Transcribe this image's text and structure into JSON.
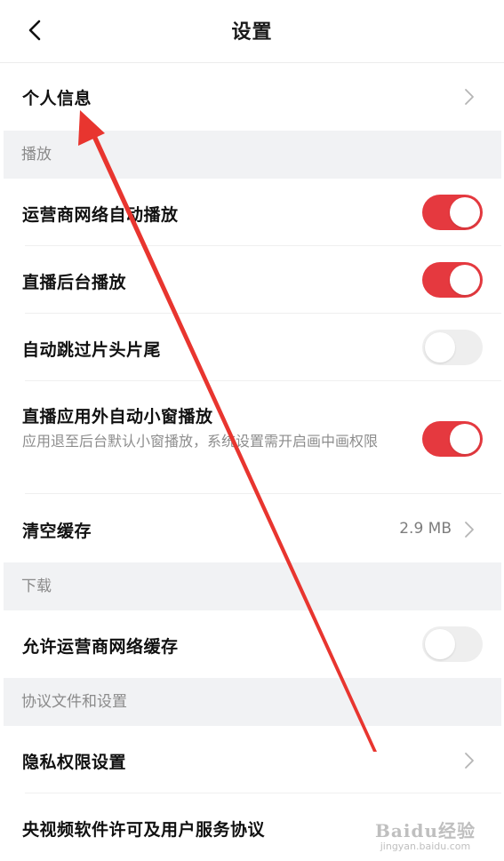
{
  "header": {
    "title": "设置"
  },
  "personal_info": {
    "label": "个人信息"
  },
  "sections": {
    "playback": "播放",
    "download": "下载",
    "agreements": "协议文件和设置"
  },
  "playback": {
    "cellular_autoplay": {
      "label": "运营商网络自动播放",
      "enabled": true
    },
    "live_background_play": {
      "label": "直播后台播放",
      "enabled": true
    },
    "skip_intro_outro": {
      "label": "自动跳过片头片尾",
      "enabled": false
    },
    "live_pip": {
      "label": "直播应用外自动小窗播放",
      "description": "应用退至后台默认小窗播放，系统设置需开启画中画权限",
      "enabled": true
    },
    "clear_cache": {
      "label": "清空缓存",
      "value": "2.9 MB"
    }
  },
  "download": {
    "allow_cellular_cache": {
      "label": "允许运营商网络缓存",
      "enabled": false
    }
  },
  "agreements": {
    "privacy_settings": {
      "label": "隐私权限设置"
    },
    "license_agreement": {
      "label": "央视频软件许可及用户服务协议"
    }
  },
  "colors": {
    "accent_red": "#e5393f",
    "section_bg": "#f1f2f4",
    "annotation_arrow": "#e8352f"
  },
  "watermark": {
    "logo": "Baidu经验",
    "url": "jingyan.baidu.com"
  }
}
